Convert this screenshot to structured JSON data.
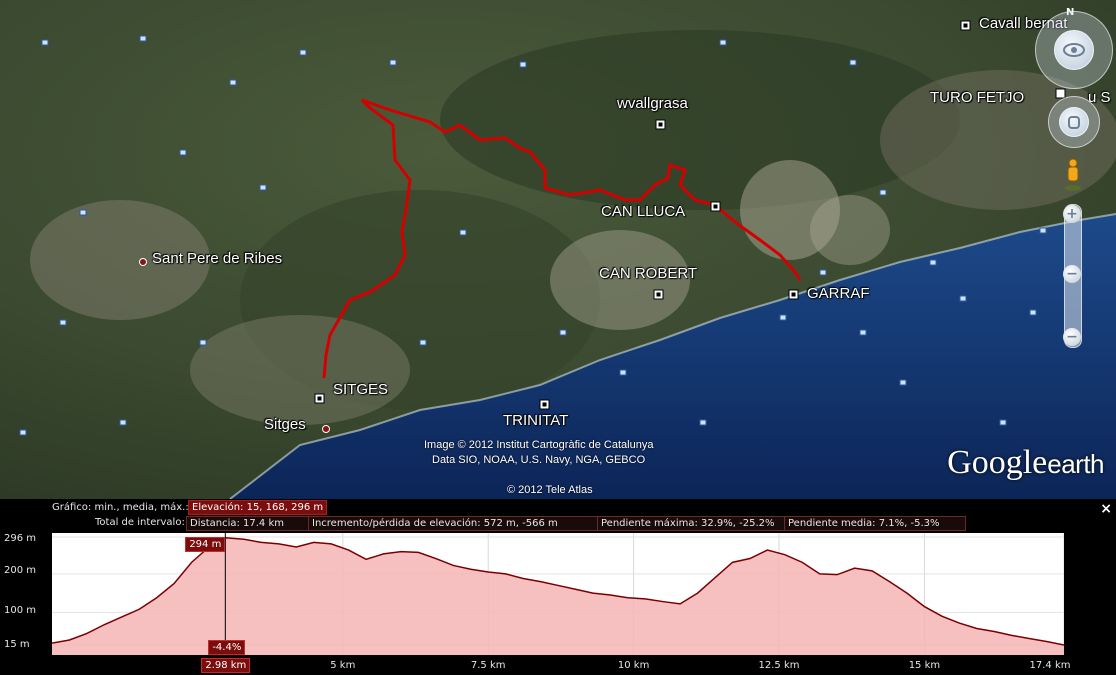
{
  "map": {
    "places": [
      {
        "id": "cavall-bernat",
        "name": "Cavall bernat"
      },
      {
        "id": "turo-fetjo",
        "name": "TURO FETJO"
      },
      {
        "id": "turo-fetjo-suffix",
        "name": "u S"
      },
      {
        "id": "wvallgrasa",
        "name": "wvallgrasa"
      },
      {
        "id": "can-lluca",
        "name": "CAN LLUCA"
      },
      {
        "id": "can-robert",
        "name": "CAN ROBERT"
      },
      {
        "id": "garraf",
        "name": "GARRAF"
      },
      {
        "id": "sant-pere",
        "name": "Sant Pere de Ribes"
      },
      {
        "id": "sitges-caps",
        "name": "SITGES"
      },
      {
        "id": "sitges",
        "name": "Sitges"
      },
      {
        "id": "trinitat",
        "name": "TRINITAT"
      }
    ],
    "copyright_lines": [
      "Image © 2012 Institut Cartogràfic de Catalunya",
      "Data SIO, NOAA, U.S. Navy, NGA, GEBCO"
    ],
    "tele_atlas": "© 2012 Tele Atlas",
    "logo_google": "Google",
    "logo_earth": "earth",
    "north_label": "N",
    "zoom_plus": "+",
    "zoom_minus": "−",
    "track_color": "#d40000"
  },
  "panel": {
    "row1_label": "Gráfico: min., media, máx.:",
    "elevation": "Elevación: 15, 168, 296 m",
    "row2_label": "Total de intervalo:",
    "distance": "Distancia: 17.4 km",
    "gain_loss": "Incremento/pérdida de elevación: 572 m, -566 m",
    "max_slope": "Pendiente máxima: 32.9%, -25.2%",
    "avg_slope": "Pendiente media: 7.1%, -5.3%",
    "close": "×",
    "cursor": {
      "elevation_label": "294 m",
      "slope_label": "-4.4%",
      "distance_label": "2.98 km",
      "km": 2.98
    },
    "fill_color": "#f6b5b5",
    "line_color": "#7a0000"
  },
  "chart_data": {
    "type": "area",
    "ylabel_ticks": [
      "296 m",
      "200 m",
      "100 m",
      "15 m"
    ],
    "y_tick_values": [
      296,
      200,
      100,
      15
    ],
    "x_tick_labels": [
      "5 km",
      "7.5 km",
      "10 km",
      "12.5 km",
      "15 km",
      "17.4 km"
    ],
    "x_tick_values": [
      5,
      7.5,
      10,
      12.5,
      15,
      17.4
    ],
    "xlim": [
      0,
      17.4
    ],
    "ylim": [
      15,
      296
    ],
    "x": [
      0,
      0.3,
      0.6,
      0.9,
      1.2,
      1.5,
      1.8,
      2.1,
      2.4,
      2.7,
      2.98,
      3.3,
      3.6,
      3.9,
      4.2,
      4.5,
      4.8,
      5.1,
      5.4,
      5.7,
      6.0,
      6.3,
      6.6,
      6.9,
      7.2,
      7.5,
      7.8,
      8.1,
      8.4,
      8.7,
      9.0,
      9.3,
      9.6,
      9.9,
      10.2,
      10.5,
      10.8,
      11.1,
      11.4,
      11.7,
      12.0,
      12.3,
      12.6,
      12.9,
      13.2,
      13.5,
      13.8,
      14.1,
      14.4,
      14.7,
      15.0,
      15.3,
      15.6,
      15.9,
      16.2,
      16.5,
      16.8,
      17.1,
      17.4
    ],
    "values": [
      20,
      28,
      45,
      68,
      88,
      108,
      138,
      175,
      230,
      270,
      294,
      290,
      282,
      278,
      270,
      282,
      278,
      262,
      238,
      252,
      258,
      256,
      240,
      222,
      212,
      205,
      200,
      188,
      180,
      170,
      160,
      150,
      145,
      138,
      135,
      128,
      122,
      150,
      190,
      230,
      240,
      262,
      250,
      230,
      200,
      198,
      215,
      208,
      180,
      150,
      115,
      90,
      72,
      58,
      50,
      40,
      32,
      24,
      15
    ]
  }
}
